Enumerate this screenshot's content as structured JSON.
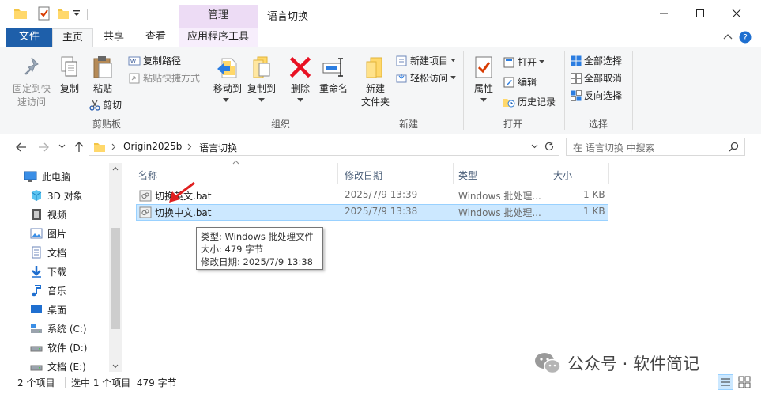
{
  "window": {
    "title": "语言切换",
    "manage_tab": "管理"
  },
  "tabs": {
    "file": "文件",
    "home": "主页",
    "share": "共享",
    "view": "查看",
    "app_tools": "应用程序工具"
  },
  "ribbon": {
    "clipboard": {
      "pin_line1": "固定到快",
      "pin_line2": "速访问",
      "copy": "复制",
      "paste": "粘贴",
      "copy_path": "复制路径",
      "paste_shortcut": "粘贴快捷方式",
      "cut": "剪切",
      "group": "剪贴板"
    },
    "organize": {
      "move_to": "移动到",
      "copy_to": "复制到",
      "delete": "删除",
      "rename": "重命名",
      "group": "组织"
    },
    "new": {
      "new_folder_line1": "新建",
      "new_folder_line2": "文件夹",
      "new_item": "新建项目",
      "easy_access": "轻松访问",
      "group": "新建"
    },
    "open": {
      "properties": "属性",
      "open": "打开",
      "edit": "编辑",
      "history": "历史记录",
      "group": "打开"
    },
    "select": {
      "select_all": "全部选择",
      "select_none": "全部取消",
      "invert": "反向选择",
      "group": "选择"
    }
  },
  "address": {
    "crumb1": "Origin2025b",
    "crumb2": "语言切换",
    "search_placeholder": "在 语言切换 中搜索"
  },
  "nav": {
    "items": [
      "此电脑",
      "3D 对象",
      "视频",
      "图片",
      "文档",
      "下载",
      "音乐",
      "桌面",
      "系统 (C:)",
      "软件 (D:)",
      "文档 (E:)"
    ]
  },
  "columns": {
    "name": "名称",
    "modified": "修改日期",
    "type": "类型",
    "size": "大小"
  },
  "files": [
    {
      "name": "切换英文.bat",
      "modified": "2025/7/9 13:39",
      "type": "Windows 批处理...",
      "size": "1 KB"
    },
    {
      "name": "切换中文.bat",
      "modified": "2025/7/9 13:38",
      "type": "Windows 批处理...",
      "size": "1 KB"
    }
  ],
  "tooltip": {
    "line1": "类型: Windows 批处理文件",
    "line2": "大小: 479 字节",
    "line3": "修改日期: 2025/7/9 13:38"
  },
  "status": {
    "count": "2 个项目",
    "selected": "选中 1 个项目  479 字节"
  },
  "watermark": "公众号 · 软件简记"
}
